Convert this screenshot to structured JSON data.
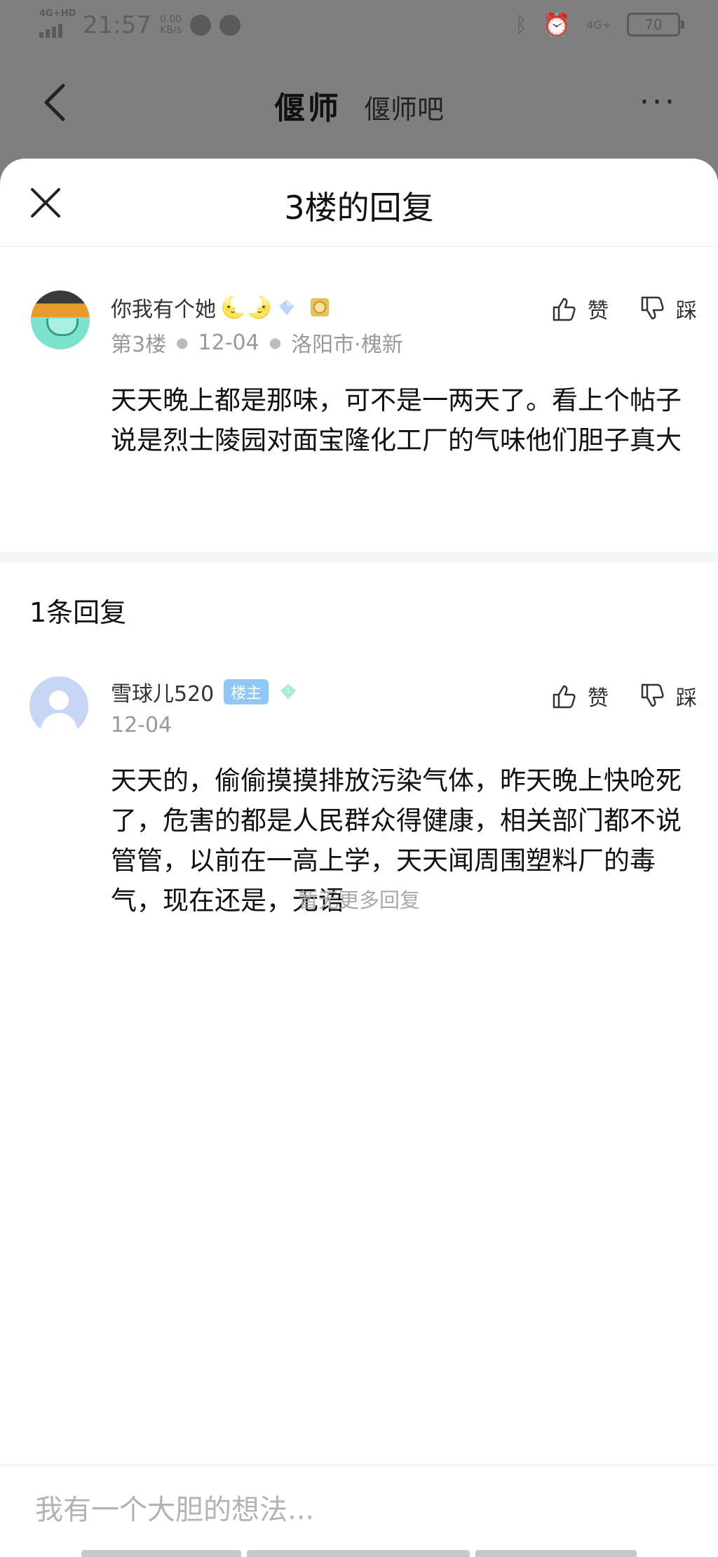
{
  "status_bar": {
    "network": "4G+HD",
    "time": "21:57",
    "speed_value": "0.00",
    "speed_unit": "KB/s",
    "net_right": "4G+",
    "battery": "70"
  },
  "background_nav": {
    "logo": "偃师",
    "title": "偃师吧",
    "more": "···"
  },
  "sheet": {
    "title": "3楼的回复"
  },
  "post": {
    "username": "你我有个她",
    "badge_moons": "🌜🌛",
    "floor": "第3楼",
    "date": "12-04",
    "location": "洛阳市·槐新",
    "like_label": "赞",
    "dislike_label": "踩",
    "content": "天天晚上都是那味，可不是一两天了。看上个帖子说是烈士陵园对面宝隆化工厂的气味他们胆子真大"
  },
  "reply_count_label": "1条回复",
  "reply": {
    "username": "雪球儿520",
    "owner_tag": "楼主",
    "level": "1",
    "date": "12-04",
    "like_label": "赞",
    "dislike_label": "踩",
    "content": "天天的，偷偷摸摸排放污染气体，昨天晚上快呛死了，危害的都是人民群众得健康，相关部门都不说管管，以前在一高上学，天天闻周围塑料厂的毒气，现在还是，无语"
  },
  "no_more_label": "暂无更多回复",
  "input": {
    "placeholder": "我有一个大胆的想法..."
  },
  "colors": {
    "overlay": "#7f7f7f",
    "owner_tag": "#8fc8f7",
    "muted": "#999999"
  }
}
